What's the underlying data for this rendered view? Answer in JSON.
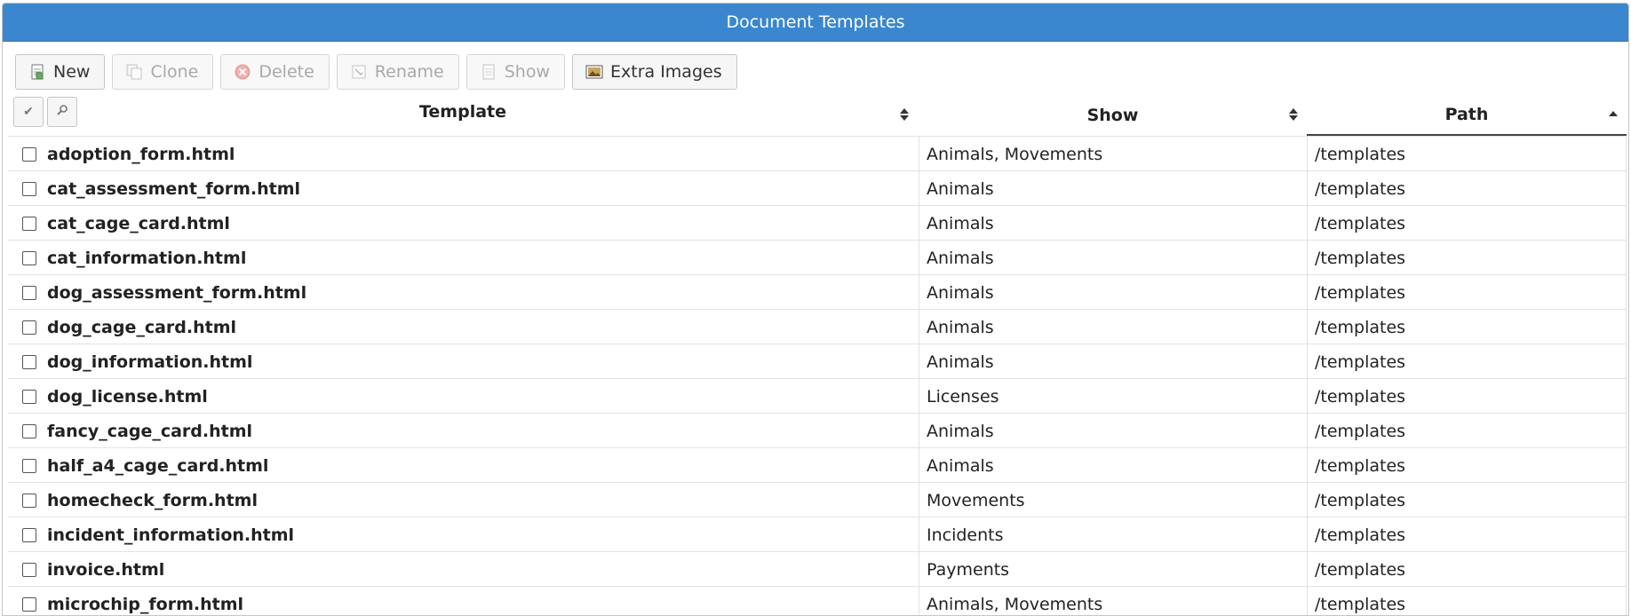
{
  "title": "Document Templates",
  "toolbar": {
    "new": {
      "label": "New",
      "icon": "new-document-icon"
    },
    "clone": {
      "label": "Clone",
      "icon": "clone-icon"
    },
    "delete": {
      "label": "Delete",
      "icon": "delete-icon"
    },
    "rename": {
      "label": "Rename",
      "icon": "rename-icon"
    },
    "show": {
      "label": "Show",
      "icon": "show-icon"
    },
    "extra_images": {
      "label": "Extra Images",
      "icon": "image-icon"
    }
  },
  "columns": {
    "template": "Template",
    "show": "Show",
    "path": "Path"
  },
  "rows": [
    {
      "template": "adoption_form.html",
      "show": "Animals, Movements",
      "path": "/templates"
    },
    {
      "template": "cat_assessment_form.html",
      "show": "Animals",
      "path": "/templates"
    },
    {
      "template": "cat_cage_card.html",
      "show": "Animals",
      "path": "/templates"
    },
    {
      "template": "cat_information.html",
      "show": "Animals",
      "path": "/templates"
    },
    {
      "template": "dog_assessment_form.html",
      "show": "Animals",
      "path": "/templates"
    },
    {
      "template": "dog_cage_card.html",
      "show": "Animals",
      "path": "/templates"
    },
    {
      "template": "dog_information.html",
      "show": "Animals",
      "path": "/templates"
    },
    {
      "template": "dog_license.html",
      "show": "Licenses",
      "path": "/templates"
    },
    {
      "template": "fancy_cage_card.html",
      "show": "Animals",
      "path": "/templates"
    },
    {
      "template": "half_a4_cage_card.html",
      "show": "Animals",
      "path": "/templates"
    },
    {
      "template": "homecheck_form.html",
      "show": "Movements",
      "path": "/templates"
    },
    {
      "template": "incident_information.html",
      "show": "Incidents",
      "path": "/templates"
    },
    {
      "template": "invoice.html",
      "show": "Payments",
      "path": "/templates"
    },
    {
      "template": "microchip_form.html",
      "show": "Animals, Movements",
      "path": "/templates"
    }
  ]
}
